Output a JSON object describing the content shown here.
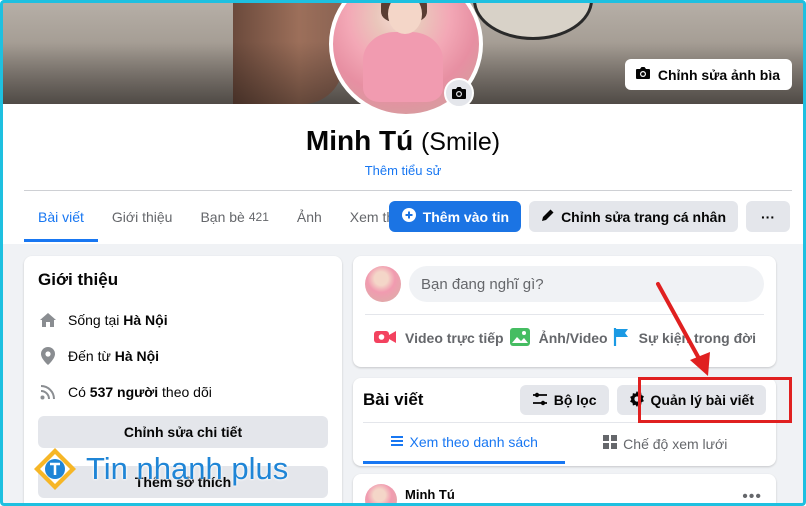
{
  "cover": {
    "edit_label": "Chỉnh sửa ảnh bìa"
  },
  "profile": {
    "name": "Minh Tú",
    "nickname": "(Smile)",
    "add_bio": "Thêm tiểu sử"
  },
  "tabs": [
    {
      "label": "Bài viết",
      "active": true
    },
    {
      "label": "Giới thiệu"
    },
    {
      "label": "Bạn bè",
      "count": "421"
    },
    {
      "label": "Ảnh"
    },
    {
      "label": "Xem thêm"
    }
  ],
  "actions": {
    "add_story": "Thêm vào tin",
    "edit_profile": "Chỉnh sửa trang cá nhân",
    "more": "···"
  },
  "intro": {
    "title": "Giới thiệu",
    "lives_prefix": "Sống tại ",
    "lives_city": "Hà Nội",
    "from_prefix": "Đến từ ",
    "from_city": "Hà Nội",
    "followers_prefix": "Có ",
    "followers_count": "537 người",
    "followers_suffix": " theo dõi",
    "edit_details": "Chỉnh sửa chi tiết",
    "add_hobbies": "Thêm sở thích"
  },
  "composer": {
    "placeholder": "Bạn đang nghĩ gì?",
    "live": "Video trực tiếp",
    "photo": "Ảnh/Video",
    "life_event": "Sự kiện trong đời"
  },
  "posts": {
    "title": "Bài viết",
    "filter": "Bộ lọc",
    "manage": "Quản lý bài viết",
    "list_view": "Xem theo danh sách",
    "grid_view": "Chế độ xem lưới",
    "first_author": "Minh Tú"
  },
  "watermark": {
    "text": "Tin nhanh plus"
  },
  "colors": {
    "accent": "#1877f2",
    "highlight": "#e02020",
    "frame": "#1ec0e0"
  }
}
